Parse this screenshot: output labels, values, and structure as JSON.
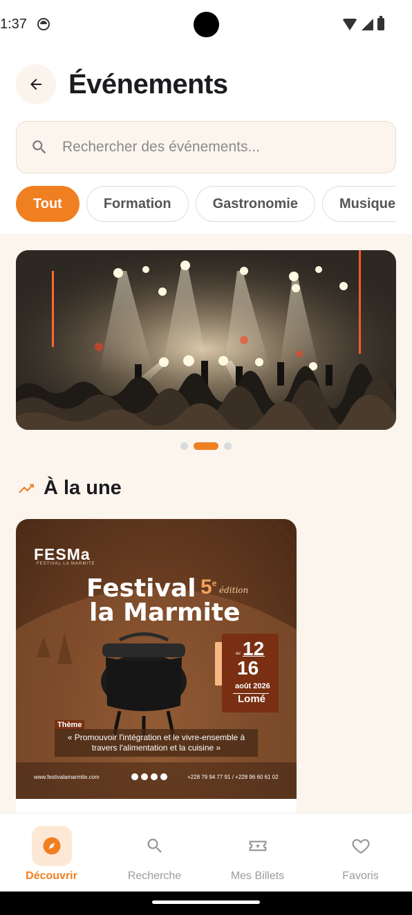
{
  "status_bar": {
    "time": "1:37"
  },
  "header": {
    "title": "Événements"
  },
  "search": {
    "placeholder": "Rechercher des événements..."
  },
  "categories": [
    "Tout",
    "Formation",
    "Gastronomie",
    "Musique"
  ],
  "carousel": {
    "page_count": 3,
    "active_index": 1
  },
  "featured": {
    "title": "À la une",
    "poster": {
      "logo": "FESMa",
      "logo_sub": "FESTIVAL LA MARMITE",
      "title_line1": "Festival",
      "title_line2": "la Marmite",
      "edition_number": "5",
      "edition_suffix": "e",
      "edition_word": "édition",
      "date_start": "12",
      "date_end": "16",
      "date_connector": "au",
      "month_year": "août 2026",
      "city": "Lomé",
      "theme_label": "Thème",
      "theme_text": "« Promouvoir l'intégration et le vivre-ensemble à travers l'alimentation et la cuisine »",
      "website": "www.festivalamarmite.com",
      "phones": "+228 79 94 77 91 / +228 96 60 61 02"
    }
  },
  "bottom_nav": [
    {
      "label": "Découvrir",
      "icon": "compass-icon",
      "active": true
    },
    {
      "label": "Recherche",
      "icon": "search-icon",
      "active": false
    },
    {
      "label": "Mes Billets",
      "icon": "ticket-icon",
      "active": false
    },
    {
      "label": "Favoris",
      "icon": "heart-icon",
      "active": false
    }
  ],
  "colors": {
    "accent": "#f07f22",
    "background": "#fbf5ee"
  }
}
